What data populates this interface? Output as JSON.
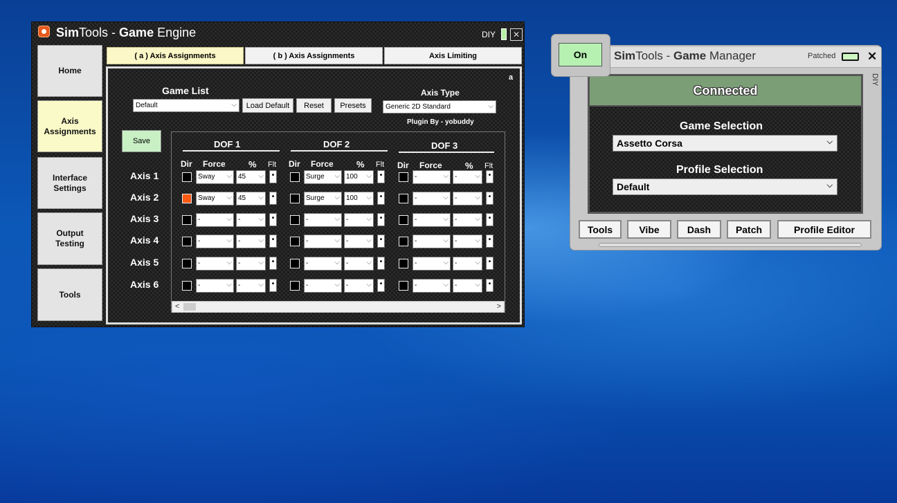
{
  "engine": {
    "title_bold1": "Sim",
    "title_rest1": "Tools - ",
    "title_bold2": "Game",
    "title_rest2": " Engine",
    "diy_label": "DIY",
    "close_glyph": "✕",
    "sidebar": [
      {
        "label": "Home"
      },
      {
        "label": "Axis Assignments"
      },
      {
        "label": "Interface Settings"
      },
      {
        "label": "Output Testing"
      },
      {
        "label": "Tools"
      }
    ],
    "tabs": [
      {
        "label": "( a ) Axis Assignments"
      },
      {
        "label": "( b ) Axis Assignments"
      },
      {
        "label": "Axis Limiting"
      }
    ],
    "corner_label": "a",
    "game_list_label": "Game List",
    "game_list_value": "Default",
    "load_default": "Load Default",
    "reset": "Reset",
    "presets": "Presets",
    "axis_type_label": "Axis Type",
    "axis_type_value": "Generic 2D Standard",
    "plugin_by": "Plugin By - yobuddy",
    "save": "Save",
    "dofs": [
      "DOF 1",
      "DOF 2",
      "DOF 3"
    ],
    "col_headers": {
      "dir": "Dir",
      "force": "Force",
      "pct": "%",
      "flt": "Flt"
    },
    "axes": [
      {
        "label": "Axis 1",
        "dof": [
          {
            "dir": false,
            "force": "Sway",
            "pct": "45"
          },
          {
            "dir": false,
            "force": "Surge",
            "pct": "100"
          },
          {
            "dir": false,
            "force": "-",
            "pct": "-"
          }
        ]
      },
      {
        "label": "Axis 2",
        "dof": [
          {
            "dir": true,
            "force": "Sway",
            "pct": "45"
          },
          {
            "dir": false,
            "force": "Surge",
            "pct": "100"
          },
          {
            "dir": false,
            "force": "-",
            "pct": "-"
          }
        ]
      },
      {
        "label": "Axis 3",
        "dof": [
          {
            "dir": false,
            "force": "-",
            "pct": "-"
          },
          {
            "dir": false,
            "force": "-",
            "pct": "-"
          },
          {
            "dir": false,
            "force": "-",
            "pct": "-"
          }
        ]
      },
      {
        "label": "Axis 4",
        "dof": [
          {
            "dir": false,
            "force": "-",
            "pct": "-"
          },
          {
            "dir": false,
            "force": "-",
            "pct": "-"
          },
          {
            "dir": false,
            "force": "-",
            "pct": "-"
          }
        ]
      },
      {
        "label": "Axis 5",
        "dof": [
          {
            "dir": false,
            "force": "-",
            "pct": "-"
          },
          {
            "dir": false,
            "force": "-",
            "pct": "-"
          },
          {
            "dir": false,
            "force": "-",
            "pct": "-"
          }
        ]
      },
      {
        "label": "Axis 6",
        "dof": [
          {
            "dir": false,
            "force": "-",
            "pct": "-"
          },
          {
            "dir": false,
            "force": "-",
            "pct": "-"
          },
          {
            "dir": false,
            "force": "-",
            "pct": "-"
          }
        ]
      }
    ],
    "flt_glyph": "•",
    "scroll_left": "<",
    "scroll_right": ">",
    "dir_on_color": "#ff5a14"
  },
  "manager": {
    "on_label": "On",
    "title_bold1": "Sim",
    "title_rest1": "Tools - ",
    "title_bold2": "Game",
    "title_rest2": " Manager",
    "patched_label": "Patched",
    "close_glyph": "✕",
    "diy_label": "DIY",
    "status": "Connected",
    "game_selection_label": "Game Selection",
    "game_selection_value": "Assetto Corsa",
    "profile_selection_label": "Profile Selection",
    "profile_selection_value": "Default",
    "buttons": [
      "Tools",
      "Vibe",
      "Dash",
      "Patch",
      "Profile Editor"
    ],
    "status_color": "#7c9e77"
  }
}
